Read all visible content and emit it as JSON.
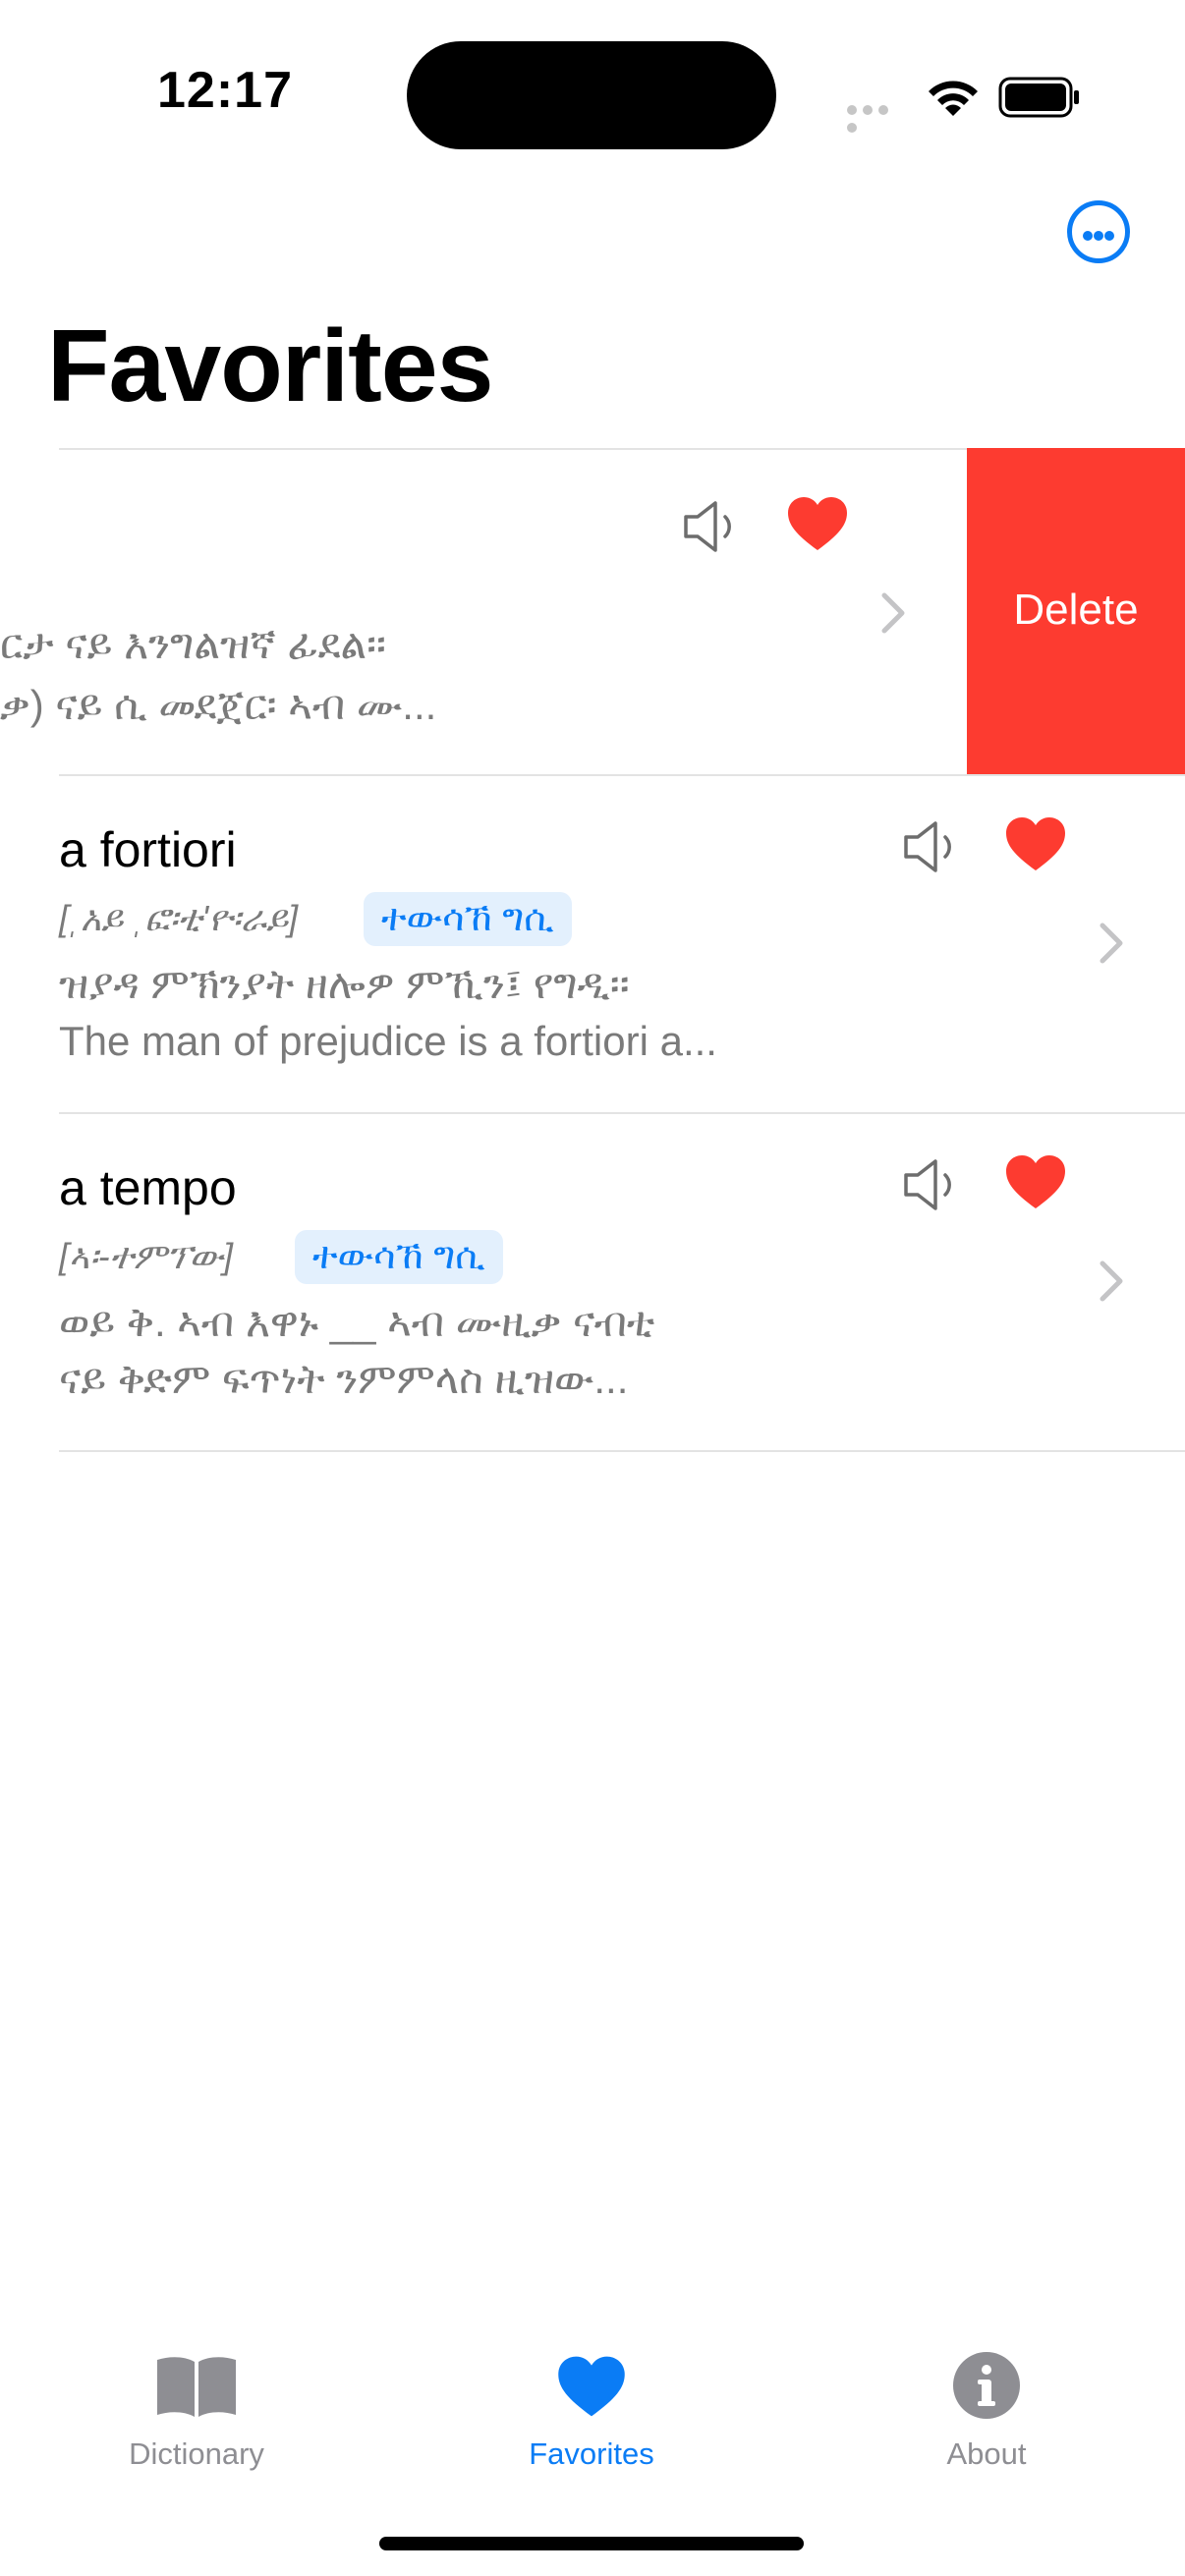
{
  "status_bar": {
    "time": "12:17"
  },
  "header": {
    "title": "Favorites"
  },
  "rows": [
    {
      "line1": "ርታ ናይ እንግልዝኛ ፊደል፡፡",
      "line2": "ቃ) ናይ ሲ መደጀር፡ ኣብ ሙ...",
      "delete_label": "Delete"
    },
    {
      "word": "a fortiori",
      "pron": "[ˌአይ ˌፎ፡ቲ'ዮ፡ራይ]",
      "tag": "ተውሳኸ ግሲ",
      "line1": "ዝያዳ ምኽንያት ዘሎዎ ምኺን፤ የግዲ፡፡",
      "line2": "The man of prejudice is a fortiori a..."
    },
    {
      "word": "a tempo",
      "pron": "[ኣ፡-ተምፕው]",
      "tag": "ተውሳኸ ግሲ",
      "line1": "ወይ ቅ. ኣብ እዋኑ __ ኣብ ሙዚቃ ናብቲ",
      "line2": "ናይ ቅድም ፍጥነት ንምምላስ ዚዝው..."
    }
  ],
  "tabs": [
    {
      "label": "Dictionary",
      "icon": "book-icon",
      "active": false
    },
    {
      "label": "Favorites",
      "icon": "heart-icon",
      "active": true
    },
    {
      "label": "About",
      "icon": "info-icon",
      "active": false
    }
  ],
  "colors": {
    "accent": "#0a7cf5",
    "heart": "#fd3b30",
    "delete": "#fd3b30",
    "inactive": "#8e8e93"
  }
}
